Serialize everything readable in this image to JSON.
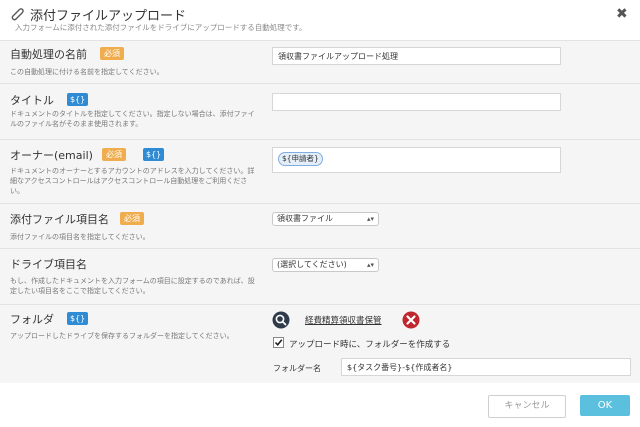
{
  "dialog": {
    "title": "添付ファイルアップロード",
    "subtitle": "入力フォームに添付された添付ファイルをドライブにアップロードする自動処理です。"
  },
  "badges": {
    "required": "必須",
    "variable": "${}"
  },
  "fields": {
    "name": {
      "label": "自動処理の名前",
      "description": "この自動処理に付ける名前を指定してください。",
      "value": "領収書ファイルアップロード処理"
    },
    "title": {
      "label": "タイトル",
      "description": "ドキュメントのタイトルを指定してください。指定しない場合は、添付ファイルのファイル名がそのまま使用されます。",
      "value": ""
    },
    "owner": {
      "label": "オーナー(email)",
      "description": "ドキュメントのオーナーとするアカウントのアドレスを入力してください。詳細なアクセスコントロールはアクセスコントロール自動処理をご利用ください。",
      "chip": "${申請者}"
    },
    "attachment": {
      "label": "添付ファイル項目名",
      "description": "添付ファイルの項目名を指定してください。",
      "selected": "領収書ファイル"
    },
    "drive_item": {
      "label": "ドライブ項目名",
      "description": "もし、作成したドキュメントを入力フォームの項目に設定するのであれば、設定したい項目名をここで指定してください。",
      "selected": "(選択してください)"
    },
    "folder": {
      "label": "フォルダ",
      "description": "アップロードしたドライブを保存するフォルダーを指定してください。",
      "folder_link": "経費精算領収書保管",
      "checkbox_label": "アップロード時に、フォルダーを作成する",
      "checkbox_checked": true,
      "folder_name_label": "フォルダー名",
      "folder_name_value": "${タスク番号}-${作成者名}"
    }
  },
  "footer": {
    "cancel_label": "キャンセル",
    "ok_label": "OK"
  }
}
